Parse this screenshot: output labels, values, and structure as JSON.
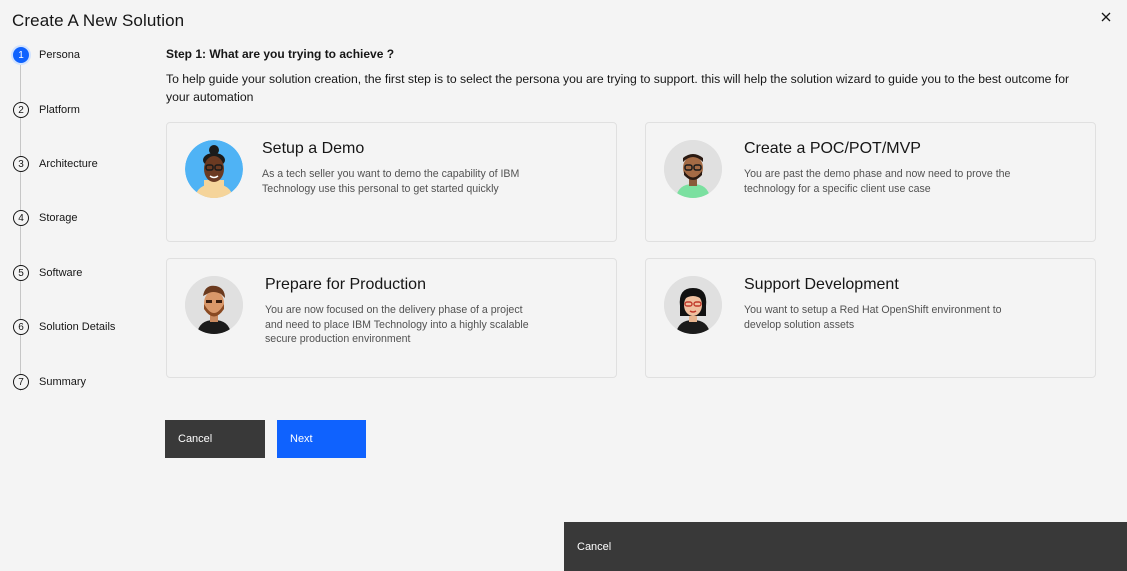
{
  "dialog": {
    "title": "Create A New Solution",
    "close_icon": "close-icon"
  },
  "steps": [
    {
      "number": "1",
      "label": "Persona",
      "active": true
    },
    {
      "number": "2",
      "label": "Platform",
      "active": false
    },
    {
      "number": "3",
      "label": "Architecture",
      "active": false
    },
    {
      "number": "4",
      "label": "Storage",
      "active": false
    },
    {
      "number": "5",
      "label": "Software",
      "active": false
    },
    {
      "number": "6",
      "label": "Solution Details",
      "active": false
    },
    {
      "number": "7",
      "label": "Summary",
      "active": false
    }
  ],
  "main": {
    "heading": "Step 1: What are you trying to achieve ?",
    "description": "To help guide your solution creation, the first step is to select the persona you are trying to support. this will help the solution wizard to guide you to the best outcome for your automation"
  },
  "personas": [
    {
      "title": "Setup a Demo",
      "description": "As a tech seller you want to demo the capability of IBM Technology use this personal to get started quickly",
      "avatar": "demo-persona-avatar"
    },
    {
      "title": "Create a POC/POT/MVP",
      "description": "You are past the demo phase and now need to prove the technology for a specific client use case",
      "avatar": "poc-persona-avatar"
    },
    {
      "title": "Prepare for Production",
      "description": "You are now focused on the delivery phase of a project and need to place IBM Technology into a highly scalable secure production environment",
      "avatar": "production-persona-avatar"
    },
    {
      "title": "Support Development",
      "description": "You want to setup a Red Hat OpenShift environment to develop solution assets",
      "avatar": "development-persona-avatar"
    }
  ],
  "actions": {
    "cancel_label": "Cancel",
    "next_label": "Next",
    "footer_cancel_label": "Cancel"
  },
  "colors": {
    "primary": "#0f62fe",
    "secondary_button": "#393939",
    "background": "#f4f4f4"
  }
}
